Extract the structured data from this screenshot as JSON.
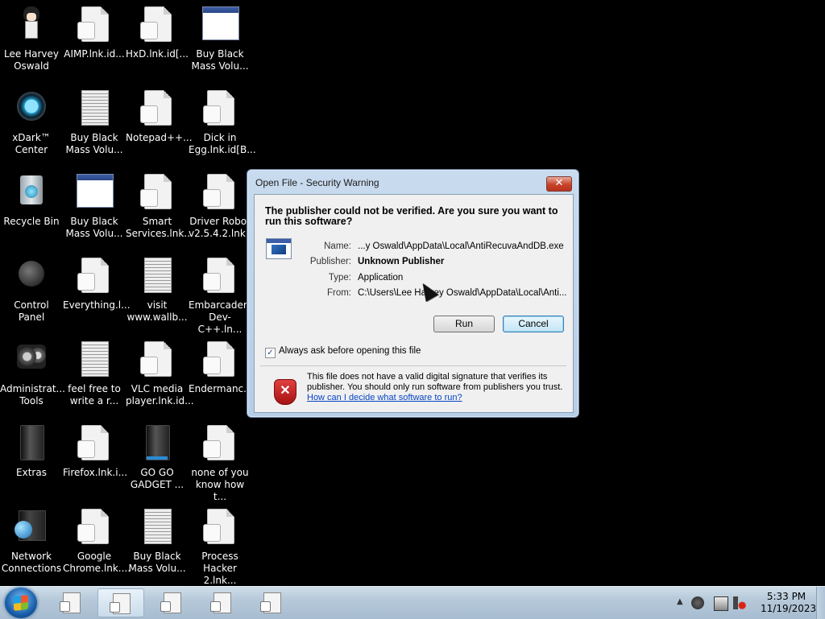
{
  "desktop": {
    "icons": [
      {
        "label": "Lee Harvey\nOswald",
        "icon": "user-avatar-icon"
      },
      {
        "label": "AIMP.lnk.id...",
        "icon": "shortcut-file-icon"
      },
      {
        "label": "HxD.lnk.id[...",
        "icon": "shortcut-file-icon"
      },
      {
        "label": "Buy Black\nMass Volu...",
        "icon": "window-icon"
      },
      {
        "label": "xDark™\nCenter",
        "icon": "orb-icon"
      },
      {
        "label": "Buy Black\nMass Volu...",
        "icon": "text-document-icon"
      },
      {
        "label": "Notepad++...",
        "icon": "shortcut-file-icon"
      },
      {
        "label": "Dick in\nEgg.lnk.id[B...",
        "icon": "shortcut-file-icon"
      },
      {
        "label": "Recycle Bin",
        "icon": "recycle-bin-icon"
      },
      {
        "label": "Buy Black\nMass Volu...",
        "icon": "window-icon"
      },
      {
        "label": "Smart\nServices.lnk...",
        "icon": "shortcut-file-icon"
      },
      {
        "label": "Driver Robot\nv2.5.4.2.lnk.i...",
        "icon": "shortcut-file-icon"
      },
      {
        "label": "Control Panel",
        "icon": "control-panel-icon"
      },
      {
        "label": "Everything.l...",
        "icon": "shortcut-file-icon"
      },
      {
        "label": "visit\nwww.wallb...",
        "icon": "text-document-icon"
      },
      {
        "label": "Embarcadero\nDev-C++.ln...",
        "icon": "shortcut-file-icon"
      },
      {
        "label": "Administrat...\nTools",
        "icon": "gears-icon"
      },
      {
        "label": "feel free to\nwrite a r...",
        "icon": "text-document-icon"
      },
      {
        "label": "VLC media\nplayer.lnk.id...",
        "icon": "shortcut-file-icon"
      },
      {
        "label": "Endermanc...",
        "icon": "shortcut-file-icon"
      },
      {
        "label": "Extras",
        "icon": "dark-folder-icon"
      },
      {
        "label": "Firefox.lnk.i...",
        "icon": "shortcut-file-icon"
      },
      {
        "label": "GO GO\nGADGET ...",
        "icon": "dark-folder-blue-icon"
      },
      {
        "label": "none of you\nknow how t...",
        "icon": "shortcut-file-icon"
      },
      {
        "label": "Network\nConnections",
        "icon": "network-globe-icon"
      },
      {
        "label": "Google\nChrome.lnk....",
        "icon": "shortcut-file-icon"
      },
      {
        "label": "Buy Black\nMass Volu...",
        "icon": "text-document-icon"
      },
      {
        "label": "Process\nHacker 2.lnk...",
        "icon": "shortcut-file-icon"
      }
    ]
  },
  "dialog": {
    "title": "Open File - Security Warning",
    "close_label": "✕",
    "question": "The publisher could not be verified.  Are you sure you want to run this software?",
    "fields": {
      "name_key": "Name:",
      "name_value": "...y Oswald\\AppData\\Local\\AntiRecuvaAndDB.exe",
      "publisher_key": "Publisher:",
      "publisher_value": "Unknown Publisher",
      "type_key": "Type:",
      "type_value": "Application",
      "from_key": "From:",
      "from_value": "C:\\Users\\Lee Harvey Oswald\\AppData\\Local\\Anti..."
    },
    "run_label": "Run",
    "cancel_label": "Cancel",
    "checkbox_label": "Always ask before opening this file",
    "checkbox_checked": true,
    "warning_text": "This file does not have a valid digital signature that verifies its publisher.  You should only run software from publishers you trust.",
    "warning_link": "How can I decide what software to run?"
  },
  "taskbar": {
    "buttons": [
      {
        "icon": "shortcut-file-icon",
        "active": false
      },
      {
        "icon": "shortcut-file-icon",
        "active": true
      },
      {
        "icon": "shortcut-file-icon",
        "active": false
      },
      {
        "icon": "shortcut-file-icon",
        "active": false
      },
      {
        "icon": "shortcut-file-icon",
        "active": false
      }
    ],
    "clock_time": "5:33 PM",
    "clock_date": "11/19/2023"
  }
}
